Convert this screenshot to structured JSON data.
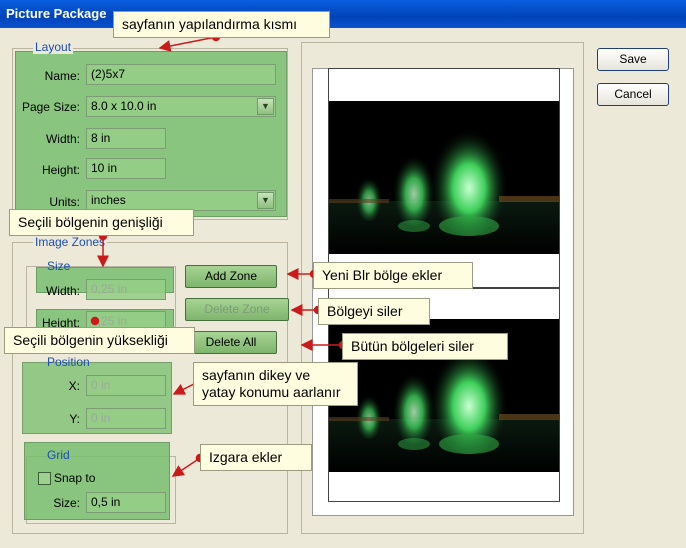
{
  "window": {
    "title": "Picture Package"
  },
  "layout": {
    "legend": "Layout",
    "name_label": "Name:",
    "name_value": "(2)5x7",
    "page_size_label": "Page Size:",
    "page_size_value": "8.0 x 10.0 in",
    "width_label": "Width:",
    "width_value": "8 in",
    "height_label": "Height:",
    "height_value": "10 in",
    "units_label": "Units:",
    "units_value": "inches"
  },
  "image_zones": {
    "legend": "Image Zones",
    "size_legend": "Size",
    "width_label": "Width:",
    "width_value": "0,25 in",
    "height_label": "Height:",
    "height_value": "0,25 in",
    "position_legend": "Position",
    "x_label": "X:",
    "x_value": "0 in",
    "y_label": "Y:",
    "y_value": "0 in",
    "grid_legend": "Grid",
    "snap_label": "Snap to",
    "grid_size_label": "Size:",
    "grid_size_value": "0,5 in",
    "add_zone": "Add Zone",
    "delete_zone": "Delete Zone",
    "delete_all": "Delete All"
  },
  "buttons": {
    "save": "Save",
    "cancel": "Cancel"
  },
  "callouts": {
    "layout_section": "sayfanın yapılandırma kısmı",
    "zone_width": "Seçili bölgenin genişliği",
    "zone_height": "Seçili bölgenin yüksekliği",
    "add_zone": "Yeni Blr bölge ekler",
    "delete_zone": "Bölgeyi siler",
    "delete_all": "Bütün bölgeleri siler",
    "position_line1": "sayfanın dikey ve",
    "position_line2": "yatay konumu aarlanır",
    "grid": "Izgara ekler"
  },
  "colors": {
    "title_bar": "#0a52d0",
    "green_overlay": "#78be6e",
    "callout_bg": "#fffde0",
    "arrow": "#cc1a1a"
  }
}
